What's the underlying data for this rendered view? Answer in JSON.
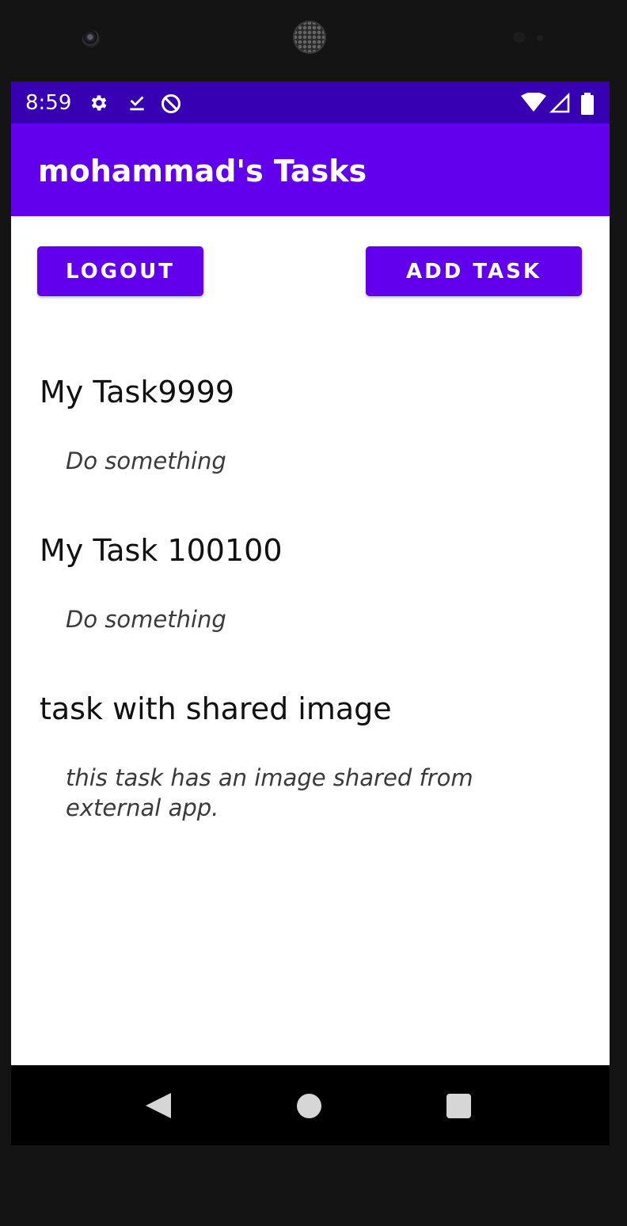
{
  "status_bar": {
    "time": "8:59",
    "left_icons": [
      "settings-gear-icon",
      "download-done-icon",
      "data-saver-icon"
    ],
    "right_icons": [
      "wifi-icon",
      "cell-signal-icon",
      "battery-icon"
    ]
  },
  "app_bar": {
    "title": "mohammad's Tasks",
    "background_color": "#6200ee",
    "status_bar_color": "#3700b3"
  },
  "actions": {
    "logout_label": "LOGOUT",
    "add_task_label": "ADD TASK"
  },
  "tasks": [
    {
      "title": "My Task9999",
      "body": "Do something"
    },
    {
      "title": "My Task 100100",
      "body": "Do something"
    },
    {
      "title": "task with shared image",
      "body": "this task has an image shared from external app."
    }
  ],
  "navigation": {
    "buttons": [
      "back-icon",
      "home-icon",
      "recents-icon"
    ]
  }
}
